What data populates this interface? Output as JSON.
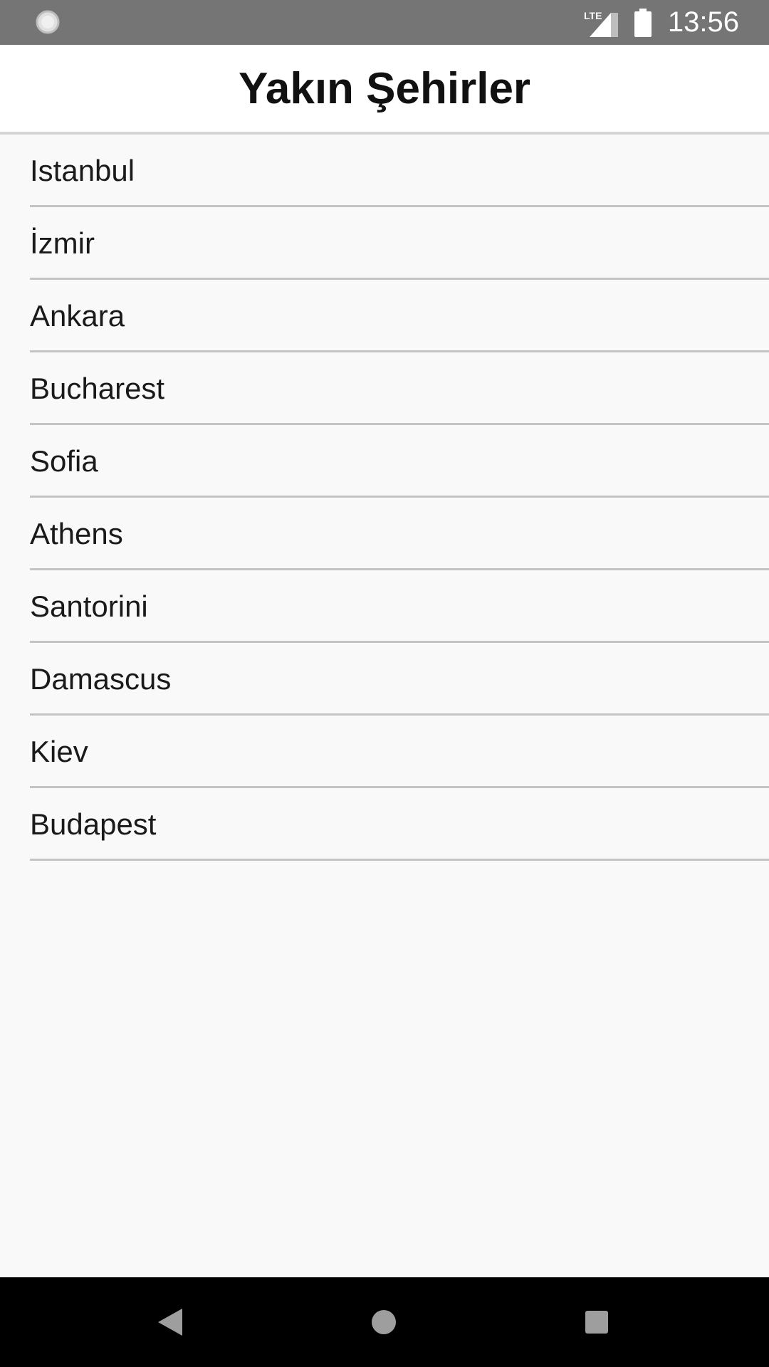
{
  "status_bar": {
    "network_label": "LTE",
    "time": "13:56",
    "left_icon": "loading-circle-icon",
    "signal_icon": "cellular-signal-icon",
    "battery_icon": "battery-full-icon"
  },
  "app_bar": {
    "title": "Yakın Şehirler"
  },
  "cities": [
    {
      "label": "Istanbul"
    },
    {
      "label": "İzmir"
    },
    {
      "label": "Ankara"
    },
    {
      "label": "Bucharest"
    },
    {
      "label": "Sofia"
    },
    {
      "label": "Athens"
    },
    {
      "label": "Santorini"
    },
    {
      "label": "Damascus"
    },
    {
      "label": "Kiev"
    },
    {
      "label": "Budapest"
    }
  ],
  "nav_bar": {
    "back_icon": "back-triangle-icon",
    "home_icon": "home-circle-icon",
    "recents_icon": "recents-square-icon"
  },
  "colors": {
    "status_bar": "#757575",
    "app_bar": "#ffffff",
    "background": "#f9f9f9",
    "divider": "#c4c4c4",
    "nav_bar": "#000000"
  }
}
